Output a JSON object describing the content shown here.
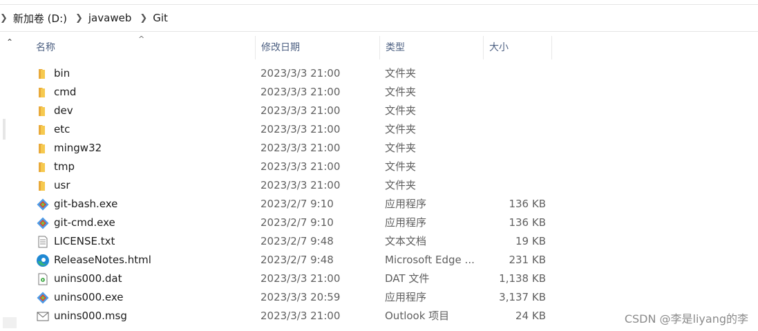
{
  "breadcrumb": [
    "新加卷 (D:)",
    "javaweb",
    "Git"
  ],
  "columns": {
    "name": "名称",
    "modified": "修改日期",
    "type": "类型",
    "size": "大小"
  },
  "files": [
    {
      "name": "bin",
      "date": "2023/3/3 21:00",
      "type": "文件夹",
      "size": "",
      "icon": "folder-icon"
    },
    {
      "name": "cmd",
      "date": "2023/3/3 21:00",
      "type": "文件夹",
      "size": "",
      "icon": "folder-icon"
    },
    {
      "name": "dev",
      "date": "2023/3/3 21:00",
      "type": "文件夹",
      "size": "",
      "icon": "folder-icon"
    },
    {
      "name": "etc",
      "date": "2023/3/3 21:00",
      "type": "文件夹",
      "size": "",
      "icon": "folder-icon"
    },
    {
      "name": "mingw32",
      "date": "2023/3/3 21:00",
      "type": "文件夹",
      "size": "",
      "icon": "folder-icon"
    },
    {
      "name": "tmp",
      "date": "2023/3/3 21:00",
      "type": "文件夹",
      "size": "",
      "icon": "folder-icon"
    },
    {
      "name": "usr",
      "date": "2023/3/3 21:00",
      "type": "文件夹",
      "size": "",
      "icon": "folder-icon"
    },
    {
      "name": "git-bash.exe",
      "date": "2023/2/7 9:10",
      "type": "应用程序",
      "size": "136 KB",
      "icon": "git-icon"
    },
    {
      "name": "git-cmd.exe",
      "date": "2023/2/7 9:10",
      "type": "应用程序",
      "size": "136 KB",
      "icon": "git-icon"
    },
    {
      "name": "LICENSE.txt",
      "date": "2023/2/7 9:48",
      "type": "文本文档",
      "size": "19 KB",
      "icon": "text-file-icon"
    },
    {
      "name": "ReleaseNotes.html",
      "date": "2023/2/7 9:48",
      "type": "Microsoft Edge ...",
      "size": "231 KB",
      "icon": "edge-icon"
    },
    {
      "name": "unins000.dat",
      "date": "2023/3/3 21:00",
      "type": "DAT 文件",
      "size": "1,138 KB",
      "icon": "dat-file-icon"
    },
    {
      "name": "unins000.exe",
      "date": "2023/3/3 20:59",
      "type": "应用程序",
      "size": "3,137 KB",
      "icon": "git-icon"
    },
    {
      "name": "unins000.msg",
      "date": "2023/3/3 21:00",
      "type": "Outlook 项目",
      "size": "24 KB",
      "icon": "mail-icon"
    }
  ],
  "watermark": "CSDN @李是liyang的李",
  "colors": {
    "folder": "#f2c14e",
    "header_text": "#4d6082",
    "git_red": "#e24329",
    "edge_blue": "#1e88d3",
    "edge_green": "#36b37e"
  }
}
